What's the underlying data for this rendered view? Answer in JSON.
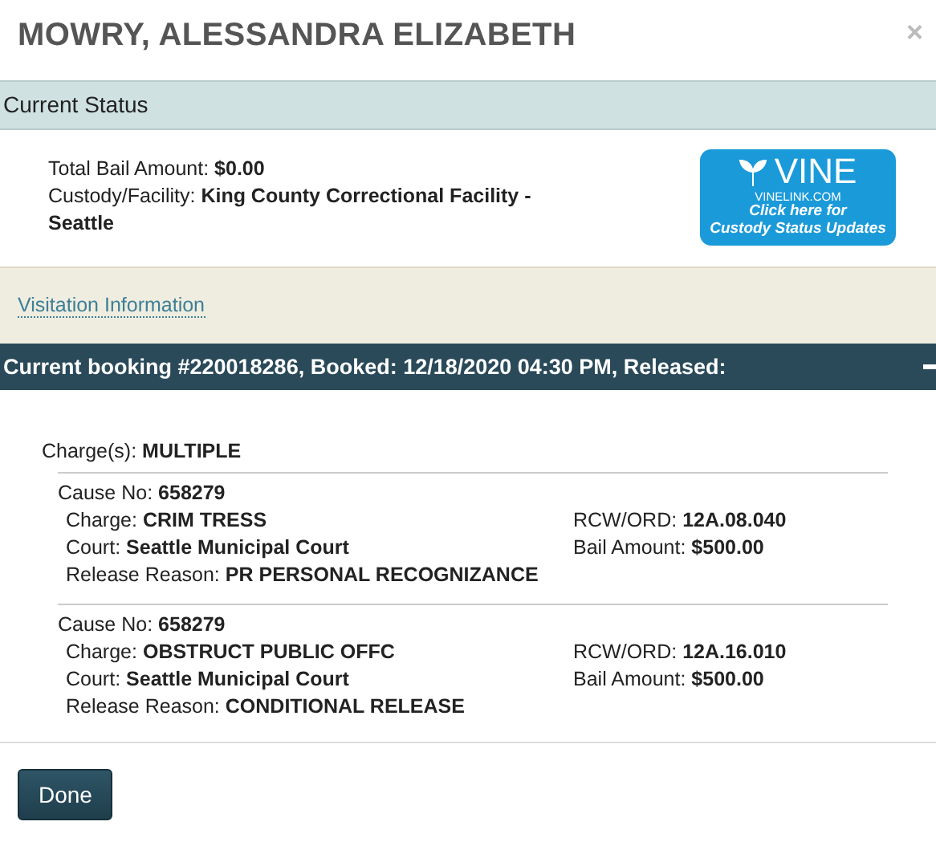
{
  "title": "MOWRY, ALESSANDRA ELIZABETH",
  "close": "×",
  "status": {
    "heading": "Current Status",
    "fields": [
      {
        "label": "Total Bail Amount:",
        "value": "$0.00"
      },
      {
        "label": "Custody/Facility:",
        "value": "King County Correctional Facility - Seattle"
      }
    ],
    "vine": {
      "logo": "VINE",
      "site": "VINELINK.COM",
      "lines": [
        "Click here for",
        "Custody Status Updates"
      ]
    }
  },
  "visitation_link": "Visitation Information",
  "booking": {
    "heading": "Current booking #220018286, Booked: 12/18/2020 04:30 PM, Released:",
    "expanded": true,
    "charges_summary": {
      "label": "Charge(s):",
      "value": "MULTIPLE"
    },
    "charges": [
      {
        "cause": {
          "label": "Cause No:",
          "value": "658279"
        },
        "left": [
          {
            "label": "Charge:",
            "value": "CRIM TRESS"
          },
          {
            "label": "Court:",
            "value": "Seattle Municipal Court"
          },
          {
            "label": "Release Reason:",
            "value": "PR PERSONAL RECOGNIZANCE"
          }
        ],
        "right": [
          {
            "label": "RCW/ORD:",
            "value": "12A.08.040"
          },
          {
            "label": "Bail Amount:",
            "value": "$500.00"
          }
        ]
      },
      {
        "cause": {
          "label": "Cause No:",
          "value": "658279"
        },
        "left": [
          {
            "label": "Charge:",
            "value": "OBSTRUCT PUBLIC OFFC"
          },
          {
            "label": "Court:",
            "value": "Seattle Municipal Court"
          },
          {
            "label": "Release Reason:",
            "value": "CONDITIONAL RELEASE"
          }
        ],
        "right": [
          {
            "label": "RCW/ORD:",
            "value": "12A.16.010"
          },
          {
            "label": "Bail Amount:",
            "value": "$500.00"
          }
        ]
      }
    ]
  },
  "buttons": [
    "Done"
  ]
}
